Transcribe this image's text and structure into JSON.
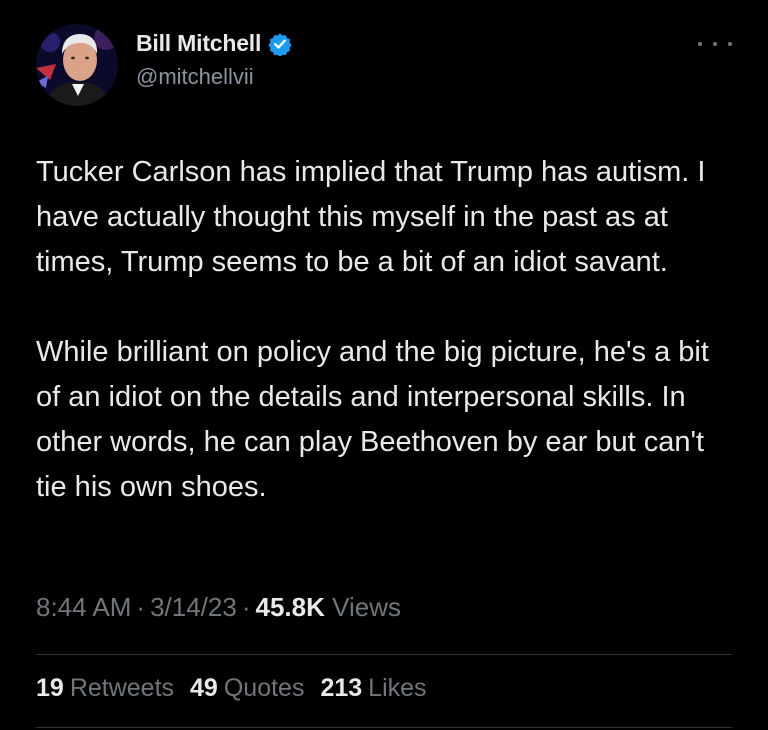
{
  "author": {
    "display_name": "Bill Mitchell",
    "handle": "@mitchellvii",
    "verified": true
  },
  "tweet": {
    "paragraphs": [
      "Tucker Carlson has implied that Trump has autism.  I have actually thought this myself in the past as at times, Trump seems to be a bit of an idiot savant.",
      "While brilliant on policy and the big picture, he's a bit of an idiot on the details and interpersonal skills.  In other words, he can play Beethoven by ear but can't tie his own shoes."
    ],
    "time": "8:44 AM",
    "date": "3/14/23",
    "views_count": "45.8K",
    "views_label": "Views"
  },
  "stats": {
    "retweets_count": "19",
    "retweets_label": "Retweets",
    "quotes_count": "49",
    "quotes_label": "Quotes",
    "likes_count": "213",
    "likes_label": "Likes"
  },
  "icons": {
    "verified": "verified-badge-icon",
    "more": "more-options-icon"
  },
  "colors": {
    "background": "#000000",
    "text_primary": "#e7e9ea",
    "text_secondary": "#71767b",
    "verified_blue": "#1d9bf0",
    "divider": "#2f3336"
  }
}
